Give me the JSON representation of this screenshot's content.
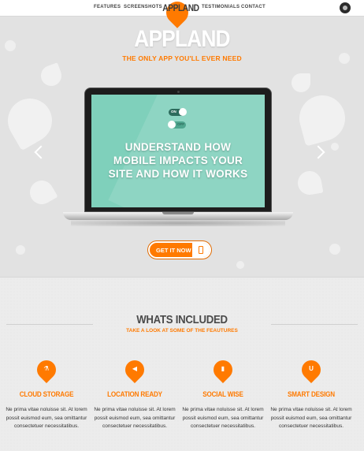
{
  "nav": {
    "links": [
      "FEATURES",
      "SCREENSHOTS",
      "TESTIMONIALS",
      "CONTACT"
    ],
    "logo": "APPLAND",
    "settings_icon": "settings-dot-icon"
  },
  "hero": {
    "title": "APPLAND",
    "subtitle": "THE ONLY APP YOU'LL EVER NEED",
    "screen": {
      "toggle_on": "ON",
      "toggle_off": "OFF",
      "headline_lines": [
        "UNDERSTAND HOW",
        "MOBILE IMPACTS YOUR",
        "SITE AND HOW IT WORKS"
      ]
    },
    "cta_label": "GET IT NOW",
    "prev_icon": "chevron-left-icon",
    "next_icon": "chevron-right-icon"
  },
  "features": {
    "title": "WHATS INCLUDED",
    "subtitle": "TAKE A LOOK AT SOME OF THE FEAUTURES",
    "items": [
      {
        "title": "CLOUD STORAGE",
        "icon": "flask-icon",
        "text": "Ne prima vitae noluisse sit. At lorem possit euismod eum, sea omittantur consectetuer necessitatibus."
      },
      {
        "title": "LOCATION READY",
        "icon": "megaphone-icon",
        "text": "Ne prima vitae noluisse sit. At lorem possit euismod eum, sea omittantur consectetuer necessitatibus."
      },
      {
        "title": "SOCIAL WISE",
        "icon": "bar-chart-icon",
        "text": "Ne prima vitae noluisse sit. At lorem possit euismod eum, sea omittantur consectetuer necessitatibus."
      },
      {
        "title": "SMART DESIGN",
        "icon": "magnet-icon",
        "text": "Ne prima vitae noluisse sit. At lorem possit euismod eum, sea omittantur consectetuer necessitatibus."
      }
    ]
  },
  "colors": {
    "accent": "#ff7a00",
    "screen": "#7fd0bb",
    "hero_bg": "#e2e2e2"
  }
}
